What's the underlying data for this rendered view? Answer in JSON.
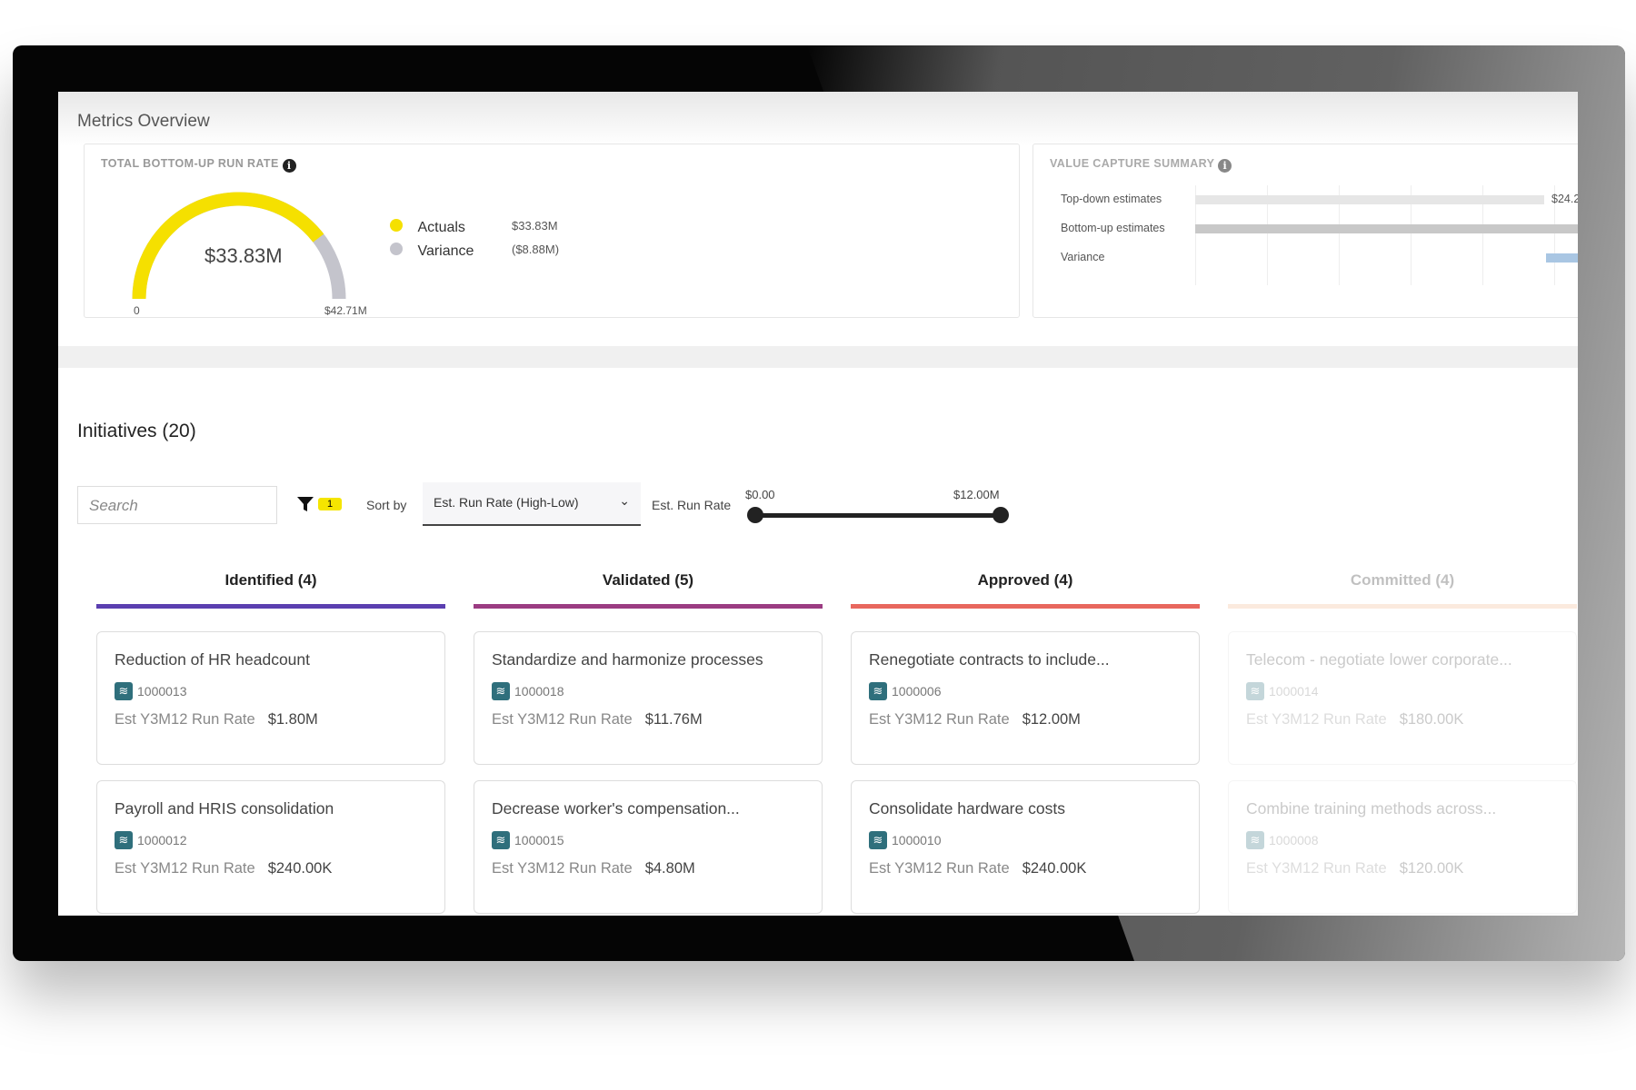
{
  "metrics": {
    "title": "Metrics Overview",
    "run_rate": {
      "title": "TOTAL BOTTOM-UP RUN RATE",
      "value": "$33.83M",
      "min": "0",
      "max": "$42.71M",
      "actual_fraction": 0.792,
      "legend": [
        {
          "label": "Actuals",
          "value": "$33.83M",
          "color": "#f5e000"
        },
        {
          "label": "Variance",
          "value": "($8.88M)",
          "color": "#c4c4cc"
        }
      ]
    },
    "value_capture": {
      "title": "VALUE CAPTURE SUMMARY",
      "rows": [
        {
          "label": "Top-down estimates",
          "value": "$24.2"
        },
        {
          "label": "Bottom-up estimates"
        },
        {
          "label": "Variance"
        }
      ]
    }
  },
  "initiatives": {
    "title": "Initiatives (20)",
    "search_placeholder": "Search",
    "filter_count": "1",
    "sort_label": "Sort by",
    "sort_value": "Est. Run Rate (High-Low)",
    "range_label": "Est. Run Rate",
    "range_min": "$0.00",
    "range_max": "$12.00M",
    "columns": [
      {
        "title": "Identified (4)",
        "color": "#5b3fb0",
        "cards": [
          {
            "name": "Reduction of HR headcount",
            "id": "1000013",
            "rate_label": "Est Y3M12 Run Rate",
            "rate": "$1.80M"
          },
          {
            "name": "Payroll and HRIS consolidation",
            "id": "1000012",
            "rate_label": "Est Y3M12 Run Rate",
            "rate": "$240.00K"
          }
        ]
      },
      {
        "title": "Validated (5)",
        "color": "#9b3c82",
        "cards": [
          {
            "name": "Standardize and harmonize processes",
            "id": "1000018",
            "rate_label": "Est Y3M12 Run Rate",
            "rate": "$11.76M"
          },
          {
            "name": "Decrease worker's compensation...",
            "id": "1000015",
            "rate_label": "Est Y3M12 Run Rate",
            "rate": "$4.80M"
          }
        ]
      },
      {
        "title": "Approved (4)",
        "color": "#e8675e",
        "cards": [
          {
            "name": "Renegotiate contracts to include...",
            "id": "1000006",
            "rate_label": "Est Y3M12 Run Rate",
            "rate": "$12.00M"
          },
          {
            "name": "Consolidate hardware costs",
            "id": "1000010",
            "rate_label": "Est Y3M12 Run Rate",
            "rate": "$240.00K"
          }
        ]
      },
      {
        "title": "Committed (4)",
        "color": "#f2b58a",
        "cards": [
          {
            "name": "Telecom - negotiate lower corporate...",
            "id": "1000014",
            "rate_label": "Est Y3M12 Run Rate",
            "rate": "$180.00K"
          },
          {
            "name": "Combine training methods across...",
            "id": "1000008",
            "rate_label": "Est Y3M12 Run Rate",
            "rate": "$120.00K"
          }
        ]
      }
    ]
  }
}
